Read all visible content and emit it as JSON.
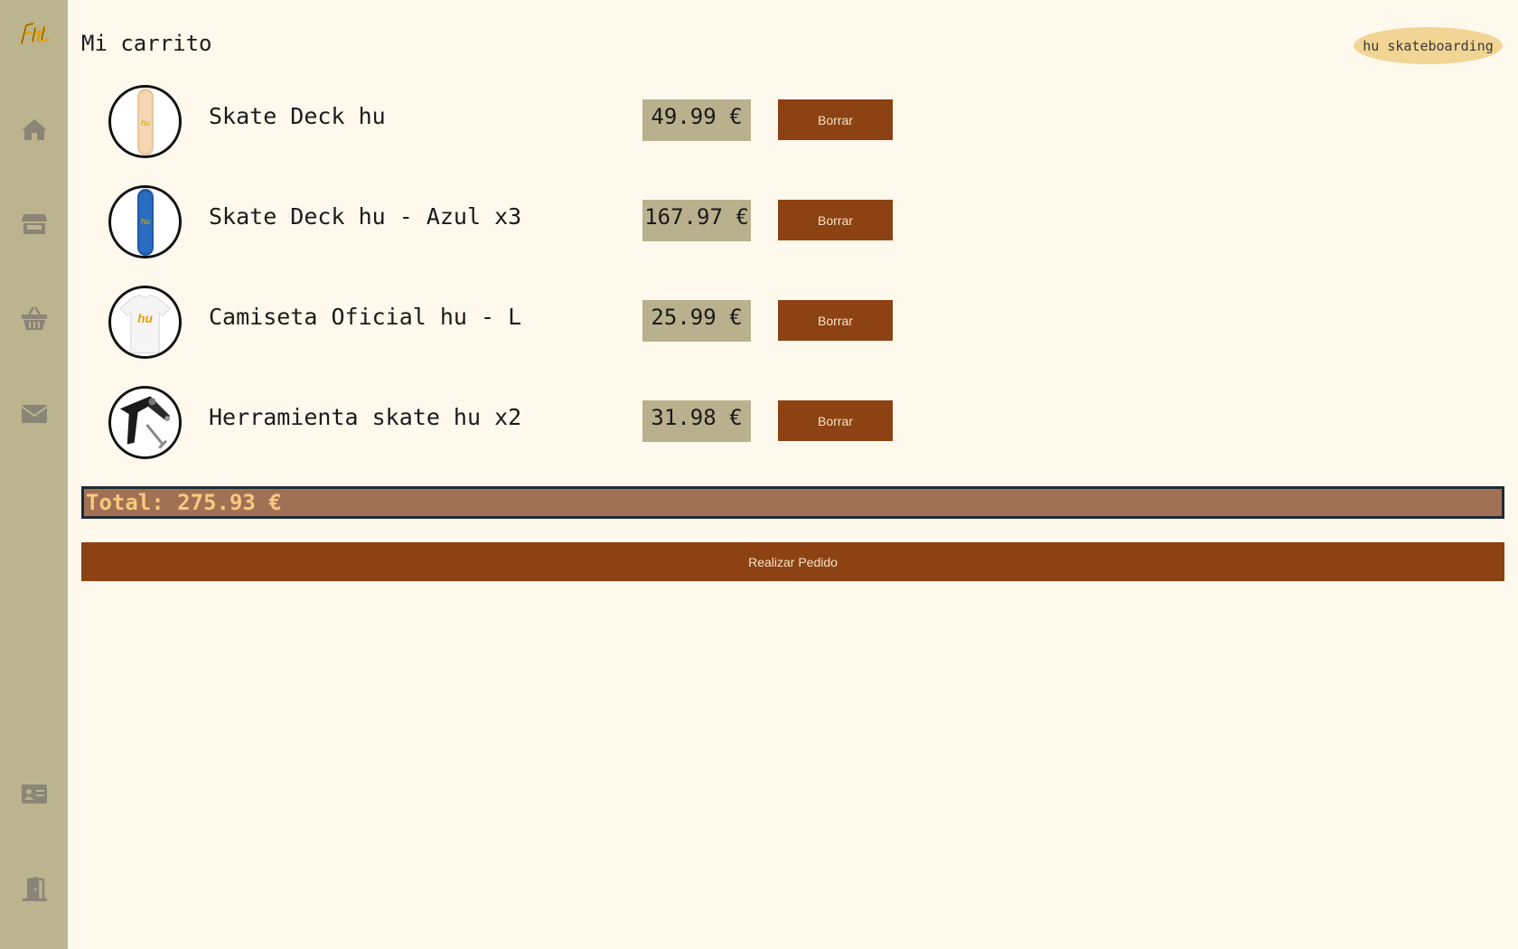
{
  "sidebar": {
    "logo_text": "hu",
    "icons": [
      "home-icon",
      "store-icon",
      "basket-icon",
      "mail-icon",
      "id-card-icon",
      "logout-door-icon"
    ]
  },
  "header": {
    "title": "Mi carrito",
    "brand": "hu skateboarding"
  },
  "cart": {
    "items": [
      {
        "name": "Skate Deck hu",
        "price": "49.99 €",
        "delete_label": "Borrar",
        "image": "natural-skate-deck"
      },
      {
        "name": "Skate Deck hu - Azul x3",
        "price": "167.97 €",
        "delete_label": "Borrar",
        "image": "blue-skate-deck"
      },
      {
        "name": "Camiseta Oficial hu - L",
        "price": "25.99 €",
        "delete_label": "Borrar",
        "image": "white-tshirt"
      },
      {
        "name": "Herramienta skate hu x2",
        "price": "31.98 €",
        "delete_label": "Borrar",
        "image": "skate-tool"
      }
    ],
    "total": "Total: 275.93 €",
    "order_label": "Realizar Pedido"
  },
  "colors": {
    "background": "#fff9ed",
    "sidebar": "#bcb38f",
    "button": "#8c4213",
    "price_bg": "#b9b08d",
    "total_bg": "#a07155",
    "total_text": "#f6c97d",
    "pill": "#f1d594"
  }
}
